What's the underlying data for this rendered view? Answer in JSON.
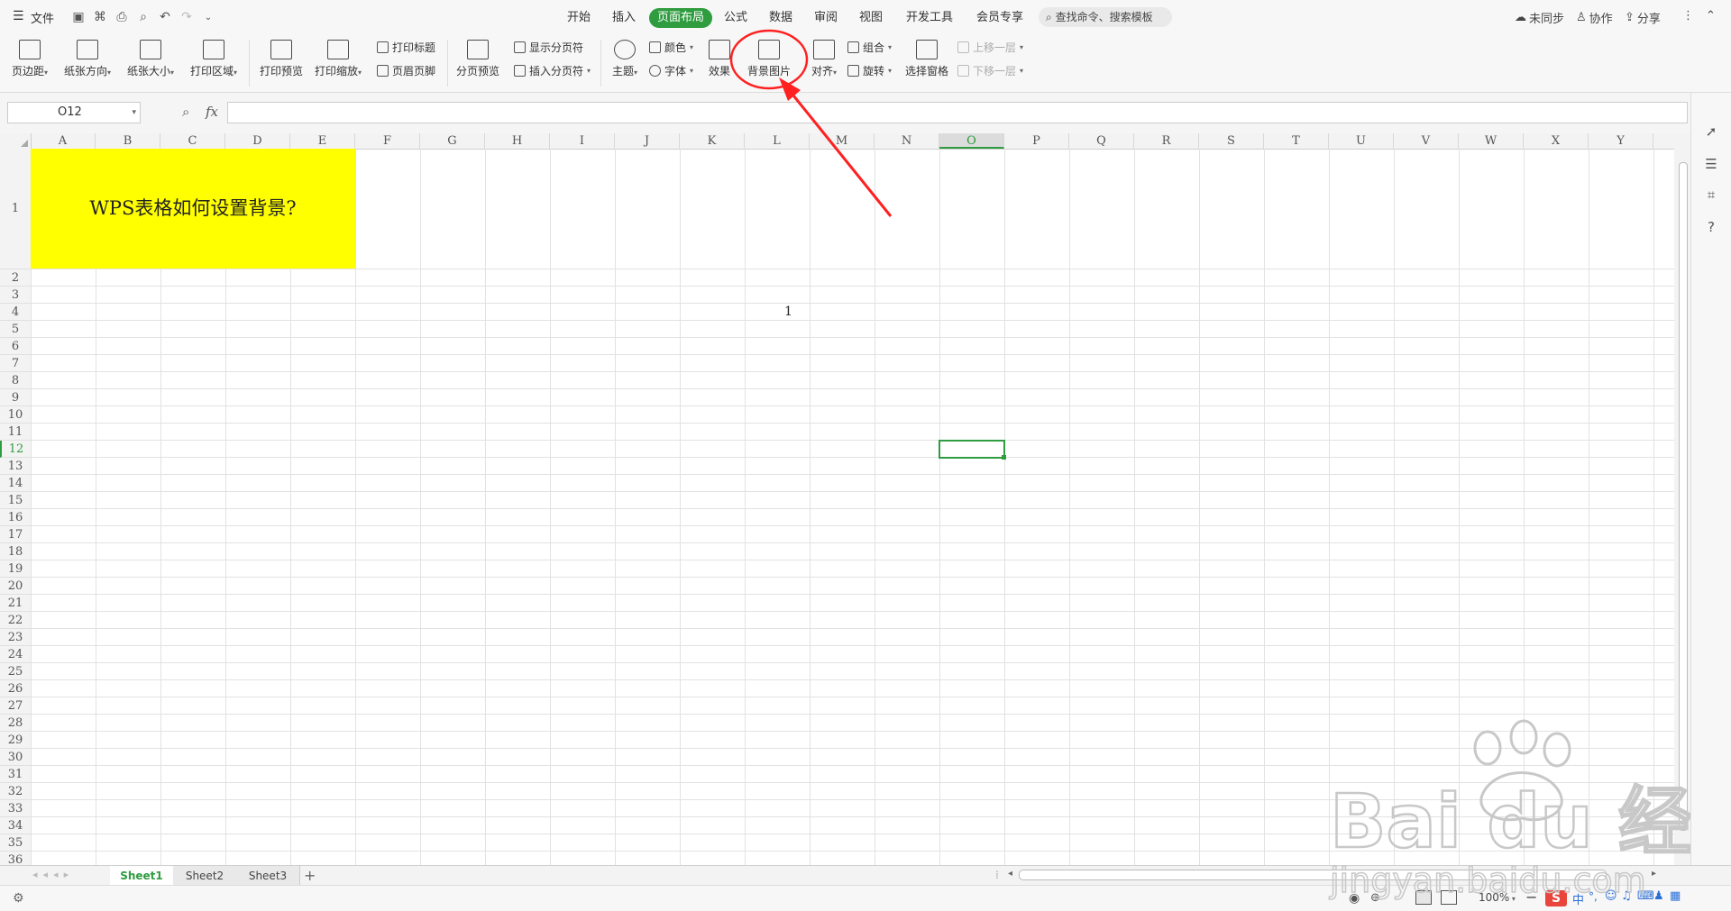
{
  "menubar": {
    "file_label": "文件",
    "tabs": [
      {
        "label": "开始"
      },
      {
        "label": "插入"
      },
      {
        "label": "页面布局"
      },
      {
        "label": "公式"
      },
      {
        "label": "数据"
      },
      {
        "label": "审阅"
      },
      {
        "label": "视图"
      },
      {
        "label": "开发工具"
      },
      {
        "label": "会员专享"
      }
    ],
    "active_tab": "页面布局",
    "search_text": "查找命令、搜索模板",
    "unsync_label": "未同步",
    "collab_label": "协作",
    "share_label": "分享"
  },
  "ribbon": {
    "margins": "页边距",
    "orientation": "纸张方向",
    "size": "纸张大小",
    "print_area": "打印区域",
    "print_preview": "打印预览",
    "print_scale": "打印缩放",
    "print_titles": "打印标题",
    "header_footer": "页眉页脚",
    "page_break_preview": "分页预览",
    "show_page_breaks": "显示分页符",
    "insert_page_break": "插入分页符",
    "theme": "主题",
    "colors": "颜色",
    "fonts": "字体",
    "effects": "效果",
    "background_image": "背景图片",
    "align": "对齐",
    "group": "组合",
    "rotate": "旋转",
    "selection_pane": "选择窗格",
    "bring_forward": "上移一层",
    "send_backward": "下移一层"
  },
  "formula_bar": {
    "name_box": "O12",
    "fx": "fx",
    "value": ""
  },
  "grid": {
    "columns": [
      "A",
      "B",
      "C",
      "D",
      "E",
      "F",
      "G",
      "H",
      "I",
      "J",
      "K",
      "L",
      "M",
      "N",
      "O",
      "P",
      "Q",
      "R",
      "S",
      "T",
      "U",
      "V",
      "W",
      "X",
      "Y"
    ],
    "selected_column": "O",
    "rows": [
      "1",
      "2",
      "3",
      "4",
      "5",
      "6",
      "7",
      "8",
      "9",
      "10",
      "11",
      "12",
      "13",
      "14",
      "15",
      "16",
      "17",
      "18",
      "19",
      "20",
      "21",
      "22",
      "23",
      "24",
      "25",
      "26",
      "27",
      "28",
      "29",
      "30",
      "31",
      "32",
      "33",
      "34",
      "35",
      "36"
    ],
    "selected_row": "12",
    "merged_text": "WPS表格如何设置背景?",
    "cell_L4": "1"
  },
  "sheets": [
    {
      "label": "Sheet1"
    },
    {
      "label": "Sheet2"
    },
    {
      "label": "Sheet3"
    }
  ],
  "status": {
    "zoom": "100%",
    "ime": "中"
  },
  "watermark": {
    "brand": "Bai du 经验",
    "url": "jingyan.baidu.com"
  },
  "colors": {
    "accent": "#2e9c3f",
    "merged_fill": "#ffff00",
    "annotation": "#ff2020"
  }
}
